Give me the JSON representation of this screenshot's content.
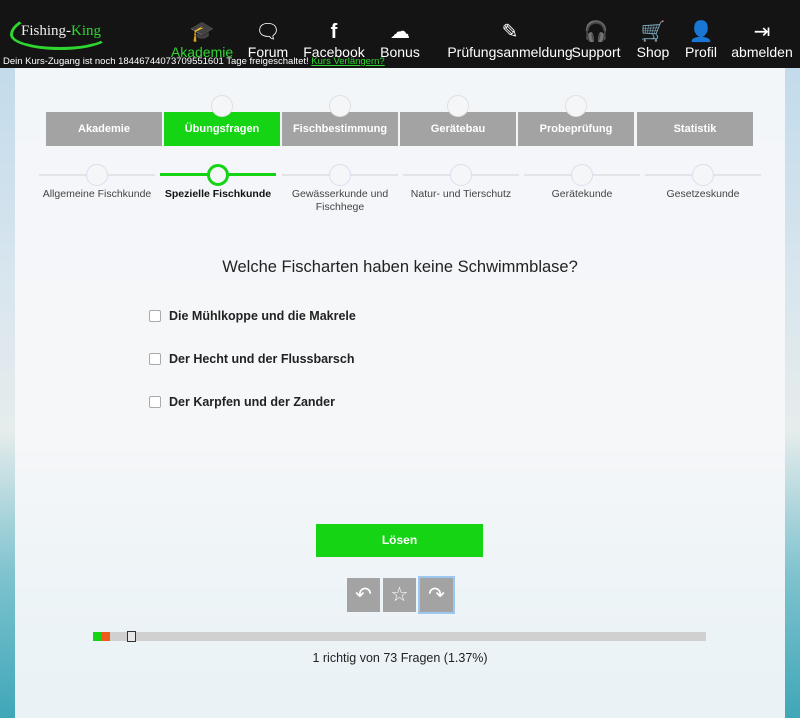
{
  "header": {
    "logo": "Fishing-King",
    "nav": [
      {
        "label": "Akademie",
        "icon": "graduation-cap-icon",
        "glyph": "🎓",
        "active": true
      },
      {
        "label": "Forum",
        "icon": "chat-icon",
        "glyph": "🗨"
      },
      {
        "label": "Facebook",
        "icon": "facebook-icon",
        "glyph": "f"
      },
      {
        "label": "Bonus",
        "icon": "cloud-download-icon",
        "glyph": "☁"
      },
      {
        "label": "Prüfungsanmeldung",
        "icon": "edit-icon",
        "glyph": "✎"
      },
      {
        "label": "Support",
        "icon": "headset-icon",
        "glyph": "🎧"
      },
      {
        "label": "Shop",
        "icon": "cart-icon",
        "glyph": "🛒"
      },
      {
        "label": "Profil",
        "icon": "user-icon",
        "glyph": "👤"
      },
      {
        "label": "abmelden",
        "icon": "logout-icon",
        "glyph": "⇥"
      }
    ],
    "notice": "Dein Kurs-Zugang ist noch 18446744073709551601 Tage freigeschaltet!",
    "notice_link": "Kurs Verlängern?"
  },
  "tabs": [
    "Akademie",
    "Übungsfragen",
    "Fischbestimmung",
    "Gerätebau",
    "Probeprüfung",
    "Statistik"
  ],
  "active_tab": 1,
  "subtabs": [
    "Allgemeine Fischkunde",
    "Spezielle Fischkunde",
    "Gewässerkunde und Fischhege",
    "Natur- und Tierschutz",
    "Gerätekunde",
    "Gesetzeskunde"
  ],
  "active_subtab": 1,
  "question": "Welche Fischarten haben keine Schwimmblase?",
  "options": [
    "Die Mühlkoppe und die Makrele",
    "Der Hecht und der Flussbarsch",
    "Der Karpfen und der Zander"
  ],
  "solve_label": "Lösen",
  "icon_buttons": [
    {
      "icon": "back-icon",
      "glyph": "↶"
    },
    {
      "icon": "star-icon",
      "glyph": "☆"
    },
    {
      "icon": "forward-icon",
      "glyph": "↷"
    }
  ],
  "progress": {
    "correct": 1,
    "wrong": 1,
    "current": 5,
    "total": 73,
    "text": "1 richtig von 73 Fragen (1.37%)",
    "colors": {
      "correct": "#14d414",
      "wrong": "#f05a1a"
    }
  }
}
